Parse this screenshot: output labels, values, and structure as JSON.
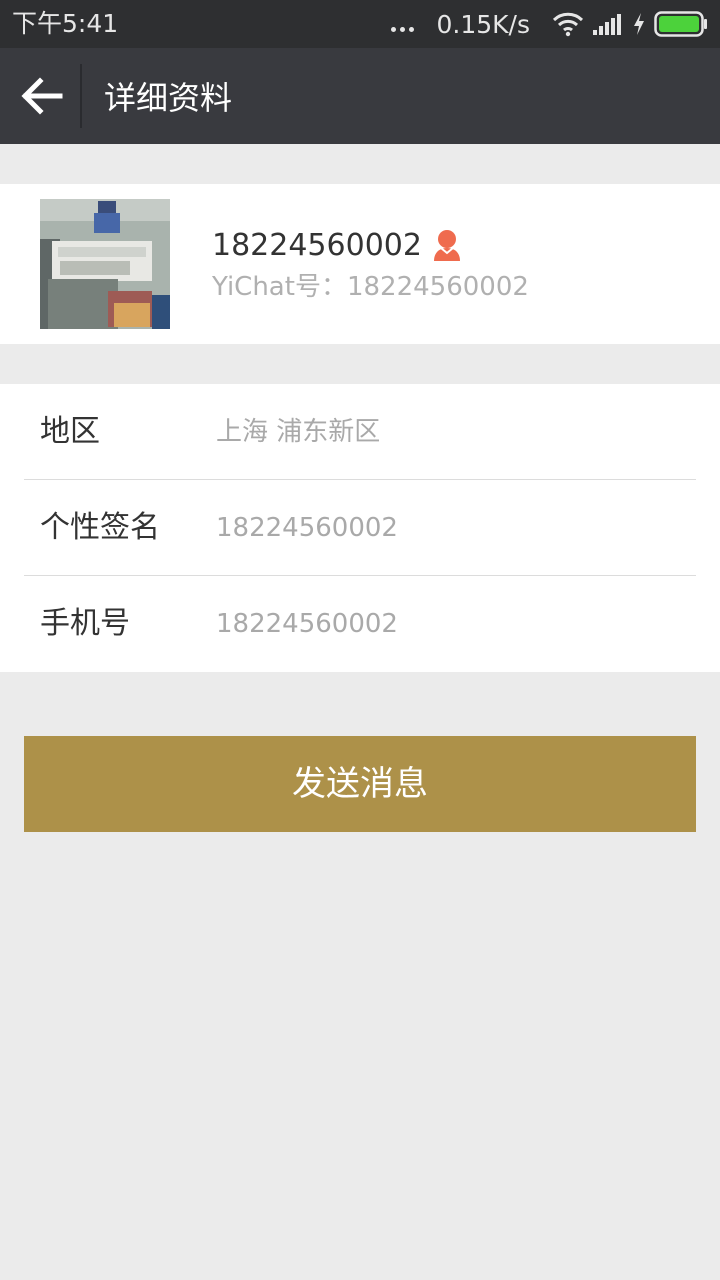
{
  "status_bar": {
    "time": "下午5:41",
    "network_speed": "0.15K/s",
    "icons": [
      "more-dots-icon",
      "wifi-icon",
      "signal-icon",
      "charging-icon",
      "battery-icon"
    ]
  },
  "app_bar": {
    "back_icon": "arrow-left-icon",
    "title": "详细资料"
  },
  "profile": {
    "name": "18224560002",
    "gender_icon": "female-user-icon",
    "id_label": "YiChat号：18224560002"
  },
  "info": {
    "rows": [
      {
        "label": "地区",
        "value": "上海 浦东新区"
      },
      {
        "label": "个性签名",
        "value": "18224560002"
      },
      {
        "label": "手机号",
        "value": "18224560002"
      }
    ]
  },
  "actions": {
    "send_message_label": "发送消息"
  },
  "colors": {
    "status_bar_bg": "#2e2f31",
    "app_bar_bg": "#393a3f",
    "page_bg": "#ebebeb",
    "button_bg": "#ad9149",
    "gender_icon": "#ef6b4e",
    "battery": "#4cd23b"
  }
}
